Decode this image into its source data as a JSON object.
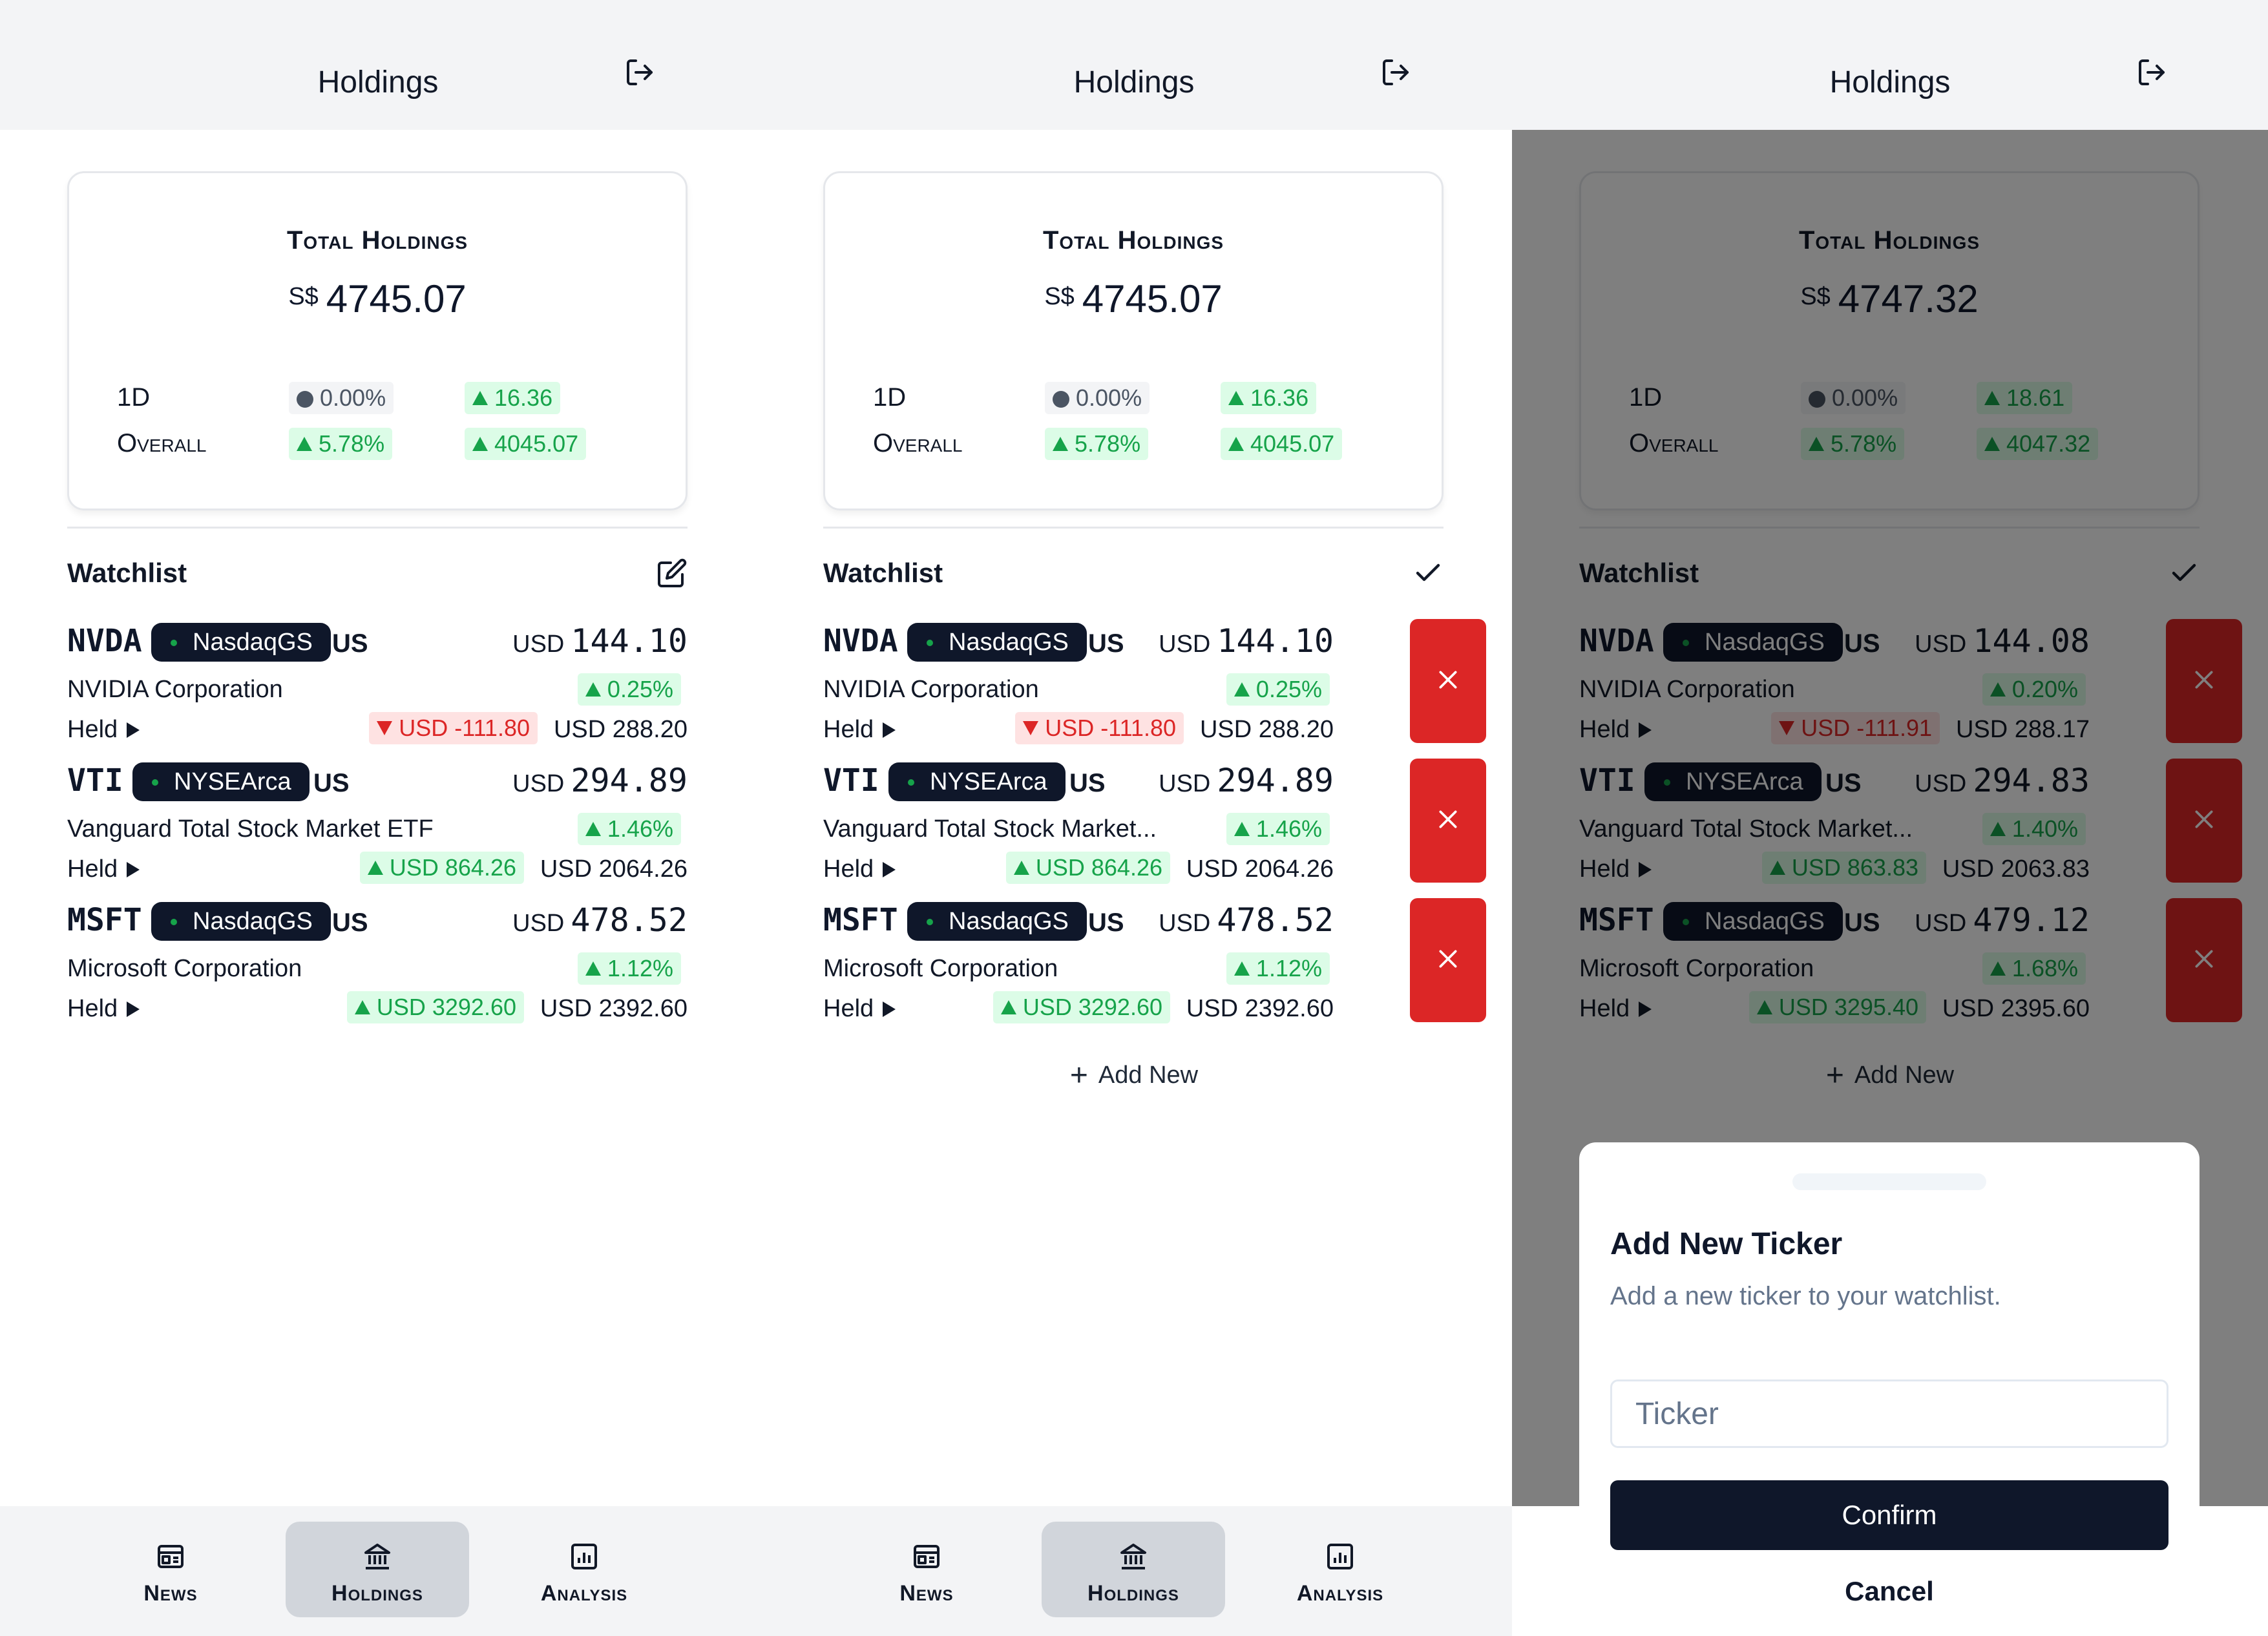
{
  "colors": {
    "up": "#16a34a",
    "down": "#dc2626",
    "neutral": "#4b5563",
    "delete": "#dc2626",
    "primary": "#0f172a"
  },
  "screens": [
    {
      "mode": "view",
      "header": {
        "title": "Holdings",
        "logout_icon": "logout-icon"
      },
      "summary": {
        "title": "Total Holdings",
        "currency": "S$",
        "total": "4745.07",
        "rows": [
          {
            "label": "1D",
            "pct": "0.00%",
            "pct_dir": "neutral",
            "abs": "16.36",
            "abs_dir": "up"
          },
          {
            "label": "Overall",
            "pct": "5.78%",
            "pct_dir": "up",
            "abs": "4045.07",
            "abs_dir": "up"
          }
        ]
      },
      "watchlist": {
        "title": "Watchlist",
        "action_icon": "edit-icon",
        "items": [
          {
            "symbol": "NVDA",
            "exchange": "NasdaqGS",
            "country": "US",
            "price_currency": "USD",
            "price": "144.10",
            "name": "NVIDIA Corporation",
            "change_pct": "0.25%",
            "change_dir": "up",
            "held_label": "Held",
            "pl": "USD -111.80",
            "pl_dir": "down",
            "market_value": "USD 288.20"
          },
          {
            "symbol": "VTI",
            "exchange": "NYSEArca",
            "country": "US",
            "price_currency": "USD",
            "price": "294.89",
            "name": "Vanguard Total Stock Market ETF",
            "change_pct": "1.46%",
            "change_dir": "up",
            "held_label": "Held",
            "pl": "USD 864.26",
            "pl_dir": "up",
            "market_value": "USD 2064.26"
          },
          {
            "symbol": "MSFT",
            "exchange": "NasdaqGS",
            "country": "US",
            "price_currency": "USD",
            "price": "478.52",
            "name": "Microsoft Corporation",
            "change_pct": "1.12%",
            "change_dir": "up",
            "held_label": "Held",
            "pl": "USD 3292.60",
            "pl_dir": "up",
            "market_value": "USD 2392.60"
          }
        ]
      },
      "add_new_label": "",
      "nav": {
        "items": [
          {
            "label": "News",
            "icon": "newspaper-icon"
          },
          {
            "label": "Holdings",
            "icon": "bank-icon"
          },
          {
            "label": "Analysis",
            "icon": "bar-chart-icon"
          }
        ],
        "active": 1
      }
    },
    {
      "mode": "edit",
      "header": {
        "title": "Holdings",
        "logout_icon": "logout-icon"
      },
      "summary": {
        "title": "Total Holdings",
        "currency": "S$",
        "total": "4745.07",
        "rows": [
          {
            "label": "1D",
            "pct": "0.00%",
            "pct_dir": "neutral",
            "abs": "16.36",
            "abs_dir": "up"
          },
          {
            "label": "Overall",
            "pct": "5.78%",
            "pct_dir": "up",
            "abs": "4045.07",
            "abs_dir": "up"
          }
        ]
      },
      "watchlist": {
        "title": "Watchlist",
        "action_icon": "check-icon",
        "items": [
          {
            "symbol": "NVDA",
            "exchange": "NasdaqGS",
            "country": "US",
            "price_currency": "USD",
            "price": "144.10",
            "name": "NVIDIA Corporation",
            "change_pct": "0.25%",
            "change_dir": "up",
            "held_label": "Held",
            "pl": "USD -111.80",
            "pl_dir": "down",
            "market_value": "USD 288.20"
          },
          {
            "symbol": "VTI",
            "exchange": "NYSEArca",
            "country": "US",
            "price_currency": "USD",
            "price": "294.89",
            "name": "Vanguard Total Stock Market...",
            "change_pct": "1.46%",
            "change_dir": "up",
            "held_label": "Held",
            "pl": "USD 864.26",
            "pl_dir": "up",
            "market_value": "USD 2064.26"
          },
          {
            "symbol": "MSFT",
            "exchange": "NasdaqGS",
            "country": "US",
            "price_currency": "USD",
            "price": "478.52",
            "name": "Microsoft Corporation",
            "change_pct": "1.12%",
            "change_dir": "up",
            "held_label": "Held",
            "pl": "USD 3292.60",
            "pl_dir": "up",
            "market_value": "USD 2392.60"
          }
        ]
      },
      "add_new_label": "Add New",
      "nav": {
        "items": [
          {
            "label": "News",
            "icon": "newspaper-icon"
          },
          {
            "label": "Holdings",
            "icon": "bank-icon"
          },
          {
            "label": "Analysis",
            "icon": "bar-chart-icon"
          }
        ],
        "active": 1
      }
    },
    {
      "mode": "dialog",
      "header": {
        "title": "Holdings",
        "logout_icon": "logout-icon"
      },
      "summary": {
        "title": "Total Holdings",
        "currency": "S$",
        "total": "4747.32",
        "rows": [
          {
            "label": "1D",
            "pct": "0.00%",
            "pct_dir": "neutral",
            "abs": "18.61",
            "abs_dir": "up"
          },
          {
            "label": "Overall",
            "pct": "5.78%",
            "pct_dir": "up",
            "abs": "4047.32",
            "abs_dir": "up"
          }
        ]
      },
      "watchlist": {
        "title": "Watchlist",
        "action_icon": "check-icon",
        "items": [
          {
            "symbol": "NVDA",
            "exchange": "NasdaqGS",
            "country": "US",
            "price_currency": "USD",
            "price": "144.08",
            "name": "NVIDIA Corporation",
            "change_pct": "0.20%",
            "change_dir": "up",
            "held_label": "Held",
            "pl": "USD -111.91",
            "pl_dir": "down",
            "market_value": "USD 288.17"
          },
          {
            "symbol": "VTI",
            "exchange": "NYSEArca",
            "country": "US",
            "price_currency": "USD",
            "price": "294.83",
            "name": "Vanguard Total Stock Market...",
            "change_pct": "1.40%",
            "change_dir": "up",
            "held_label": "Held",
            "pl": "USD 863.83",
            "pl_dir": "up",
            "market_value": "USD 2063.83"
          },
          {
            "symbol": "MSFT",
            "exchange": "NasdaqGS",
            "country": "US",
            "price_currency": "USD",
            "price": "479.12",
            "name": "Microsoft Corporation",
            "change_pct": "1.68%",
            "change_dir": "up",
            "held_label": "Held",
            "pl": "USD 3295.40",
            "pl_dir": "up",
            "market_value": "USD 2395.60"
          }
        ]
      },
      "add_new_label": "Add New",
      "dialog": {
        "title": "Add New Ticker",
        "description": "Add a new ticker to your watchlist.",
        "input_placeholder": "Ticker",
        "input_value": "",
        "confirm_label": "Confirm",
        "cancel_label": "Cancel"
      }
    }
  ]
}
